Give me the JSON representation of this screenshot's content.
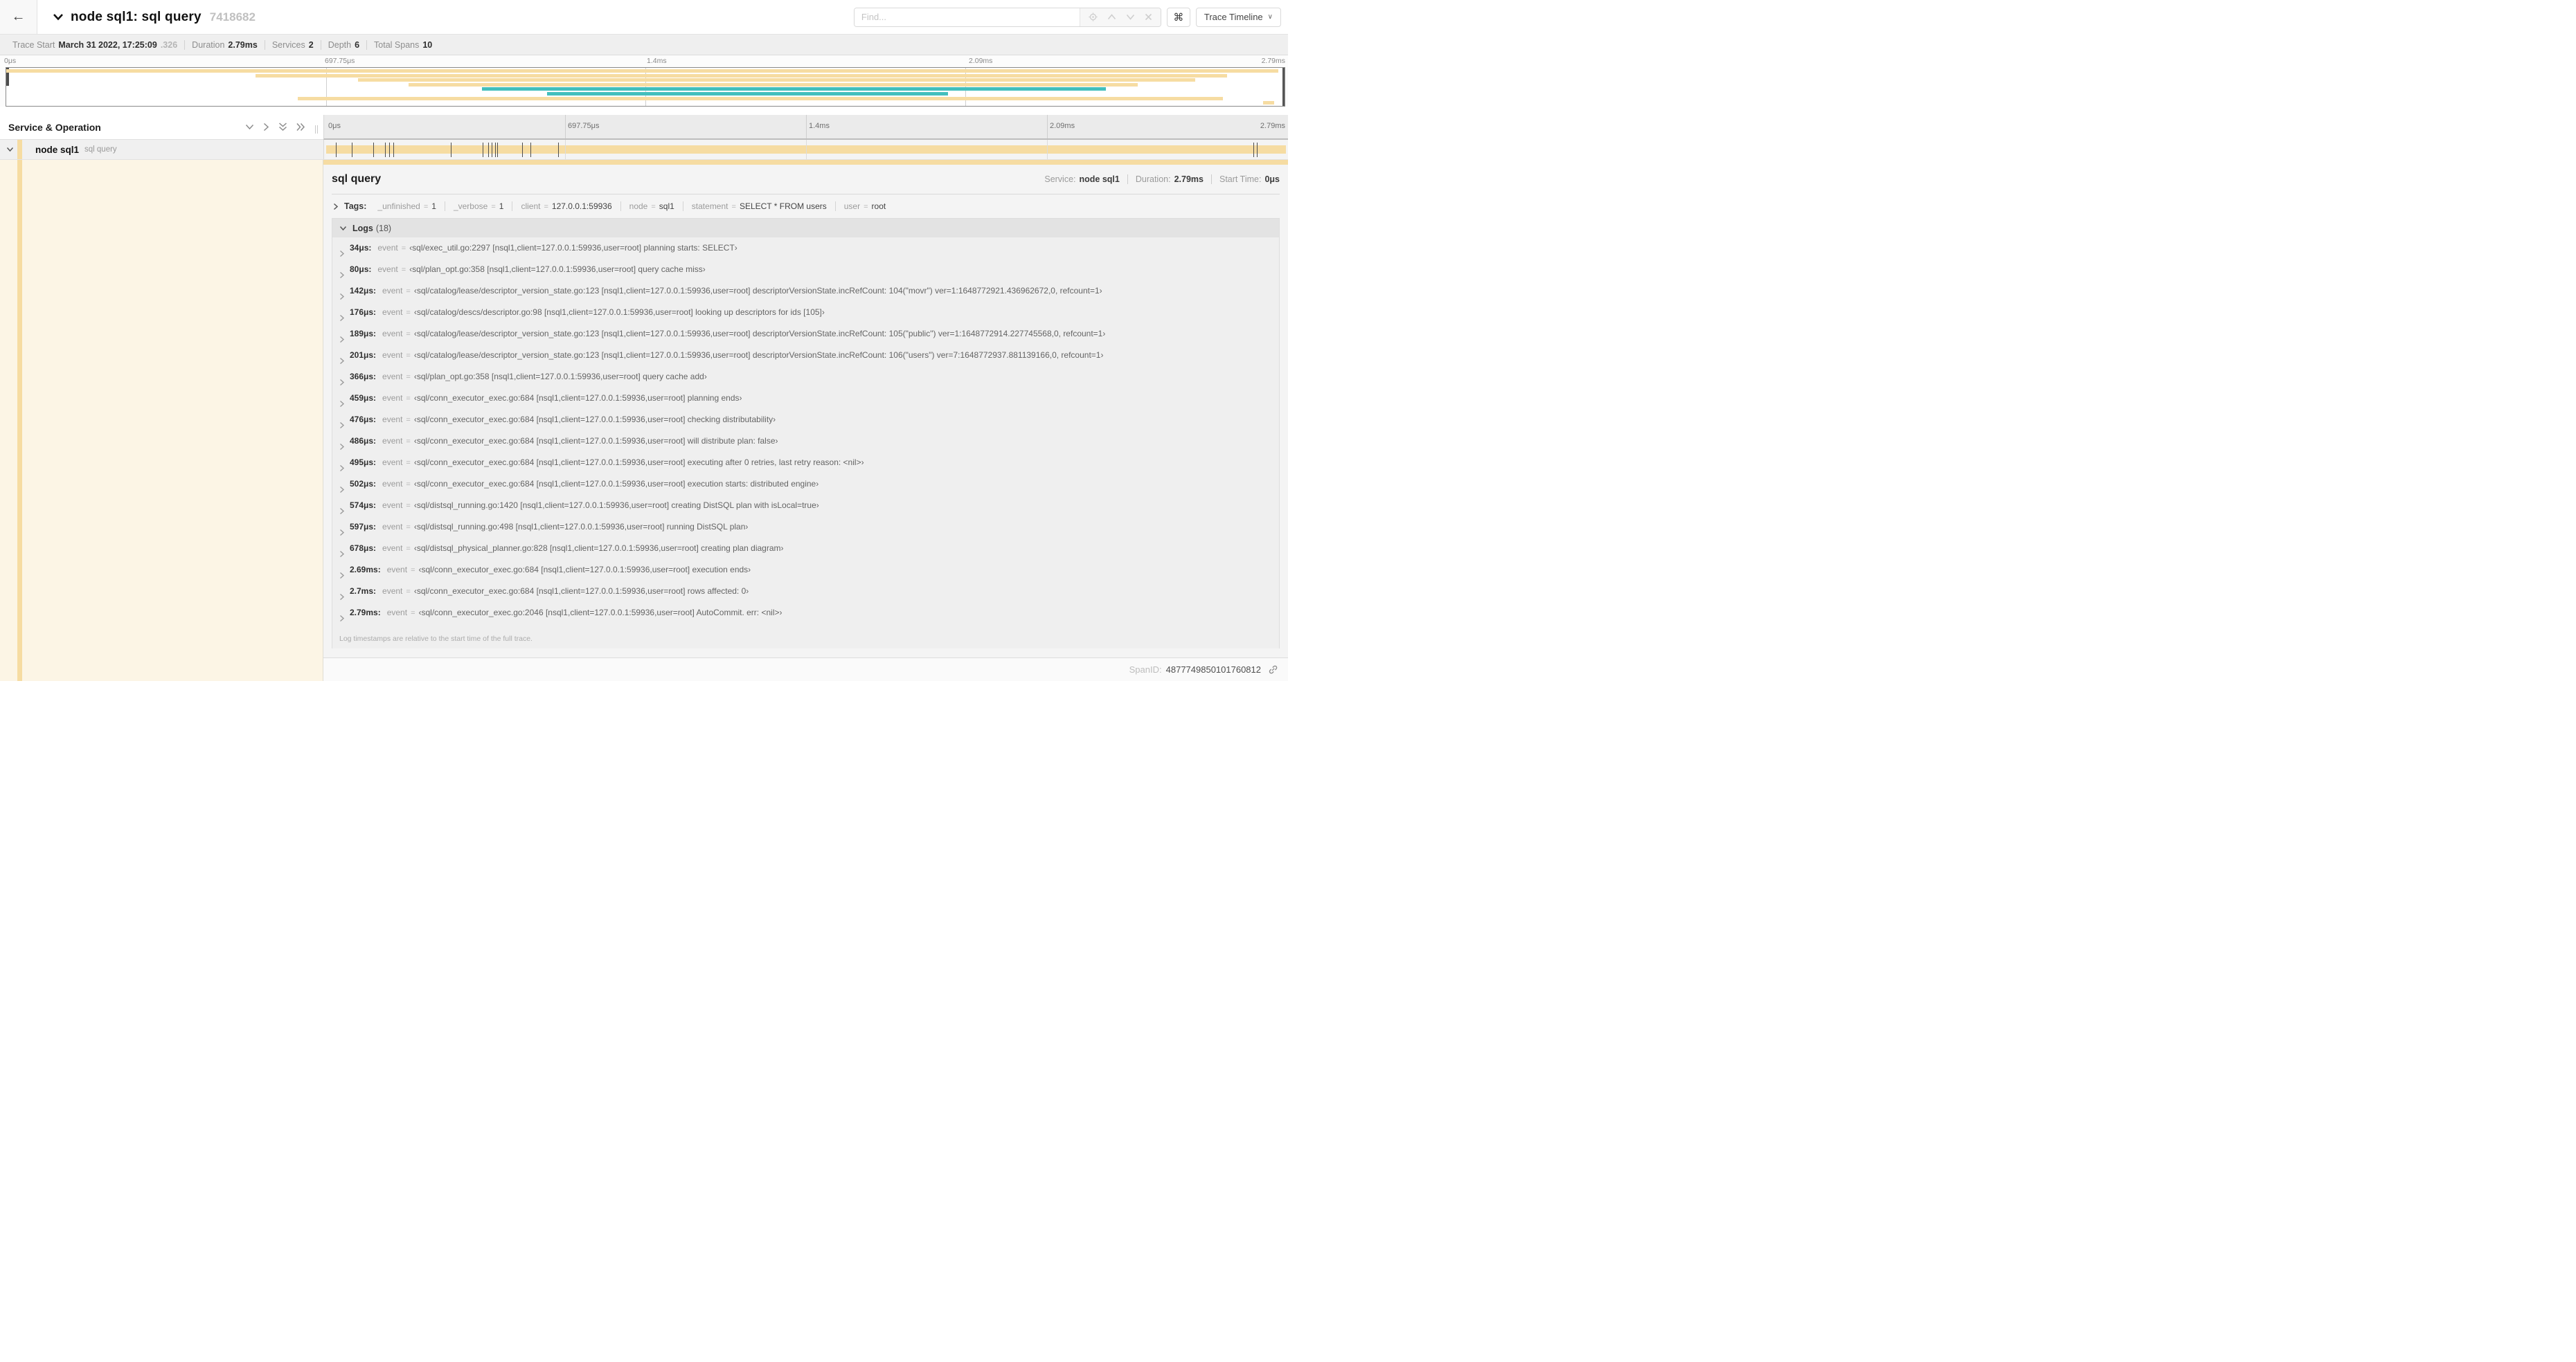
{
  "colors": {
    "tan": "#F6DCA2",
    "teal": "#43BFBD",
    "cream": "#FCF5E5"
  },
  "header": {
    "back_icon": "←",
    "title": "node sql1: sql query",
    "trace_id": "7418682",
    "find_placeholder": "Find...",
    "shortcut_icon": "⌘",
    "view_button_label": "Trace Timeline",
    "view_caret": "∨"
  },
  "summary": {
    "items": [
      {
        "label": "Trace Start",
        "value": "March 31 2022, 17:25:09",
        "suffix": ".326"
      },
      {
        "label": "Duration",
        "value": "2.79ms"
      },
      {
        "label": "Services",
        "value": "2"
      },
      {
        "label": "Depth",
        "value": "6"
      },
      {
        "label": "Total Spans",
        "value": "10"
      }
    ]
  },
  "timeline": {
    "ticks": [
      "0μs",
      "697.75μs",
      "1.4ms",
      "2.09ms",
      "2.79ms"
    ],
    "tick_positions": [
      0,
      25,
      50,
      75,
      100
    ],
    "duration_us": 2790
  },
  "minimap": {
    "bars": [
      {
        "row": 0,
        "start": 0,
        "end": 99.5,
        "color": "tan"
      },
      {
        "row": 1,
        "start": 19.5,
        "end": 95.5,
        "color": "tan"
      },
      {
        "row": 2,
        "start": 27.5,
        "end": 93.0,
        "color": "tan"
      },
      {
        "row": 3,
        "start": 31.5,
        "end": 88.5,
        "color": "tan"
      },
      {
        "row": 4,
        "start": 37.2,
        "end": 86.0,
        "color": "teal"
      },
      {
        "row": 5,
        "start": 42.3,
        "end": 73.7,
        "color": "teal"
      },
      {
        "row": 6,
        "start": 22.8,
        "end": 95.2,
        "color": "tan"
      },
      {
        "row": 7,
        "start": 98.3,
        "end": 99.2,
        "color": "tan"
      }
    ]
  },
  "left_head": {
    "title": "Service & Operation"
  },
  "row": {
    "service": "node sql1",
    "operation": "sql query"
  },
  "detail": {
    "title": "sql query",
    "meta": [
      {
        "label": "Service:",
        "value": "node sql1"
      },
      {
        "label": "Duration:",
        "value": "2.79ms"
      },
      {
        "label": "Start Time:",
        "value": "0μs"
      }
    ],
    "tags_label": "Tags:",
    "tags": [
      {
        "key": "_unfinished",
        "value": "1"
      },
      {
        "key": "_verbose",
        "value": "1"
      },
      {
        "key": "client",
        "value": "127.0.0.1:59936"
      },
      {
        "key": "node",
        "value": "sql1"
      },
      {
        "key": "statement",
        "value": "SELECT * FROM users"
      },
      {
        "key": "user",
        "value": "root"
      }
    ],
    "logs_label": "Logs",
    "logs_count": "(18)",
    "logs": [
      {
        "t": "34μs",
        "us": 34,
        "key": "event",
        "value": "‹sql/exec_util.go:2297 [nsql1,client=127.0.0.1:59936,user=root] planning starts: SELECT›"
      },
      {
        "t": "80μs",
        "us": 80,
        "key": "event",
        "value": "‹sql/plan_opt.go:358 [nsql1,client=127.0.0.1:59936,user=root] query cache miss›"
      },
      {
        "t": "142μs",
        "us": 142,
        "key": "event",
        "value": "‹sql/catalog/lease/descriptor_version_state.go:123 [nsql1,client=127.0.0.1:59936,user=root] descriptorVersionState.incRefCount: 104(\"movr\") ver=1:1648772921.436962672,0, refcount=1›"
      },
      {
        "t": "176μs",
        "us": 176,
        "key": "event",
        "value": "‹sql/catalog/descs/descriptor.go:98 [nsql1,client=127.0.0.1:59936,user=root] looking up descriptors for ids [105]›"
      },
      {
        "t": "189μs",
        "us": 189,
        "key": "event",
        "value": "‹sql/catalog/lease/descriptor_version_state.go:123 [nsql1,client=127.0.0.1:59936,user=root] descriptorVersionState.incRefCount: 105(\"public\") ver=1:1648772914.227745568,0, refcount=1›"
      },
      {
        "t": "201μs",
        "us": 201,
        "key": "event",
        "value": "‹sql/catalog/lease/descriptor_version_state.go:123 [nsql1,client=127.0.0.1:59936,user=root] descriptorVersionState.incRefCount: 106(\"users\") ver=7:1648772937.881139166,0, refcount=1›"
      },
      {
        "t": "366μs",
        "us": 366,
        "key": "event",
        "value": "‹sql/plan_opt.go:358 [nsql1,client=127.0.0.1:59936,user=root] query cache add›"
      },
      {
        "t": "459μs",
        "us": 459,
        "key": "event",
        "value": "‹sql/conn_executor_exec.go:684 [nsql1,client=127.0.0.1:59936,user=root] planning ends›"
      },
      {
        "t": "476μs",
        "us": 476,
        "key": "event",
        "value": "‹sql/conn_executor_exec.go:684 [nsql1,client=127.0.0.1:59936,user=root] checking distributability›"
      },
      {
        "t": "486μs",
        "us": 486,
        "key": "event",
        "value": "‹sql/conn_executor_exec.go:684 [nsql1,client=127.0.0.1:59936,user=root] will distribute plan: false›"
      },
      {
        "t": "495μs",
        "us": 495,
        "key": "event",
        "value": "‹sql/conn_executor_exec.go:684 [nsql1,client=127.0.0.1:59936,user=root] executing after 0 retries, last retry reason: <nil>›"
      },
      {
        "t": "502μs",
        "us": 502,
        "key": "event",
        "value": "‹sql/conn_executor_exec.go:684 [nsql1,client=127.0.0.1:59936,user=root] execution starts: distributed engine›"
      },
      {
        "t": "574μs",
        "us": 574,
        "key": "event",
        "value": "‹sql/distsql_running.go:1420 [nsql1,client=127.0.0.1:59936,user=root] creating DistSQL plan with isLocal=true›"
      },
      {
        "t": "597μs",
        "us": 597,
        "key": "event",
        "value": "‹sql/distsql_running.go:498 [nsql1,client=127.0.0.1:59936,user=root] running DistSQL plan›"
      },
      {
        "t": "678μs",
        "us": 678,
        "key": "event",
        "value": "‹sql/distsql_physical_planner.go:828 [nsql1,client=127.0.0.1:59936,user=root] creating plan diagram›"
      },
      {
        "t": "2.69ms",
        "us": 2690,
        "key": "event",
        "value": "‹sql/conn_executor_exec.go:684 [nsql1,client=127.0.0.1:59936,user=root] execution ends›"
      },
      {
        "t": "2.7ms",
        "us": 2700,
        "key": "event",
        "value": "‹sql/conn_executor_exec.go:684 [nsql1,client=127.0.0.1:59936,user=root] rows affected: 0›"
      },
      {
        "t": "2.79ms",
        "us": 2790,
        "key": "event",
        "value": "‹sql/conn_executor_exec.go:2046 [nsql1,client=127.0.0.1:59936,user=root] AutoCommit. err: <nil>›"
      }
    ],
    "footer_note": "Log timestamps are relative to the start time of the full trace.",
    "span_id_label": "SpanID:",
    "span_id": "4877749850101760812"
  }
}
